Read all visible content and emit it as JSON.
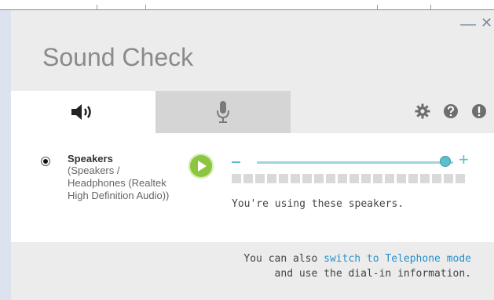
{
  "window": {
    "title": "Sound Check",
    "minimize": "—",
    "close": "✕"
  },
  "tabs": [
    {
      "name": "speakers",
      "icon": "speaker-icon",
      "selected": true
    },
    {
      "name": "microphone",
      "icon": "microphone-icon",
      "selected": false
    }
  ],
  "header_icons": [
    "gear-icon",
    "help-icon",
    "alert-icon"
  ],
  "device": {
    "name": "Speakers",
    "description": "(Speakers / Headphones (Realtek High Definition Audio))",
    "selected": true
  },
  "volume": {
    "minus": "–",
    "plus": "+",
    "level": 0.95
  },
  "status": "You're using these speakers.",
  "footer": {
    "prefix": "You can also ",
    "link": "switch to Telephone mode",
    "line2": "and use the dial-in information."
  },
  "colors": {
    "accent": "#5bbfcd",
    "play": "#8cc63f",
    "link": "#2a8fc9"
  }
}
